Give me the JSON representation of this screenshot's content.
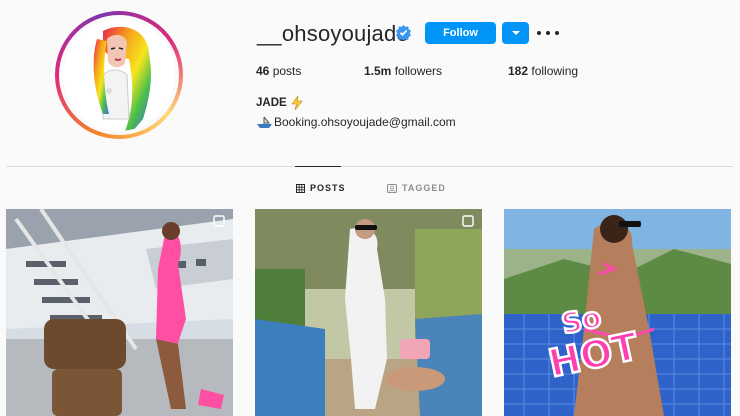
{
  "profile": {
    "username": "__ohsoyoujade",
    "follow_label": "Follow",
    "stats": {
      "posts_count": "46",
      "posts_label": "posts",
      "followers_count": "1.5m",
      "followers_label": "followers",
      "following_count": "182",
      "following_label": "following"
    },
    "full_name": "JADE",
    "bio_email": "Booking.ohsoyoujade@gmail.com"
  },
  "tabs": {
    "posts": "POSTS",
    "tagged": "TAGGED"
  },
  "posts": [
    {
      "alt": "post-1"
    },
    {
      "alt": "post-2"
    },
    {
      "alt": "post-3",
      "overlay_text": "So HOT"
    }
  ],
  "colors": {
    "accent": "#0095f6",
    "text": "#262626",
    "muted": "#8e8e8e",
    "divider": "#dbdbdb"
  },
  "icons": [
    "verified-badge-icon",
    "chevron-down-icon",
    "more-options-icon",
    "lightning-icon",
    "boat-icon",
    "grid-icon",
    "tagged-icon",
    "multi-post-icon"
  ]
}
